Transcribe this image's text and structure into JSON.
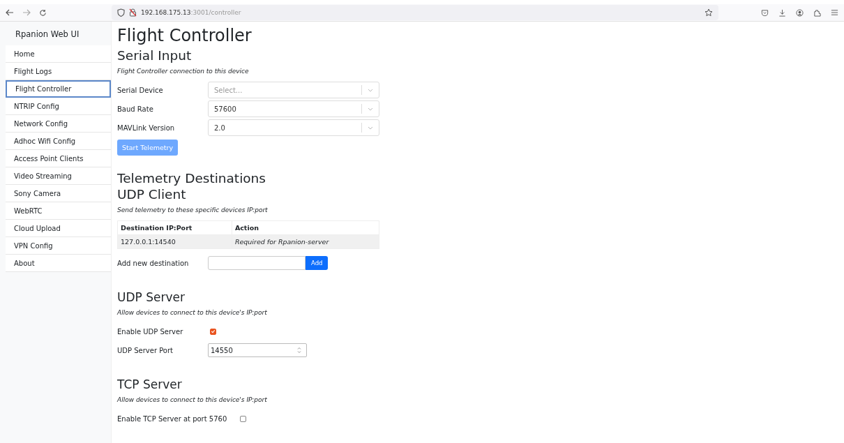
{
  "browser": {
    "address": {
      "host": "192.168.175.13",
      "path": ":3001/controller"
    }
  },
  "sidebar": {
    "brand": "Rpanion Web UI",
    "items": [
      {
        "label": "Home",
        "selected": false
      },
      {
        "label": "Flight Logs",
        "selected": false
      },
      {
        "label": "Flight Controller",
        "selected": true
      },
      {
        "label": "NTRIP Config",
        "selected": false
      },
      {
        "label": "Network Config",
        "selected": false
      },
      {
        "label": "Adhoc Wifi Config",
        "selected": false
      },
      {
        "label": "Access Point Clients",
        "selected": false
      },
      {
        "label": "Video Streaming",
        "selected": false
      },
      {
        "label": "Sony Camera",
        "selected": false
      },
      {
        "label": "WebRTC",
        "selected": false
      },
      {
        "label": "Cloud Upload",
        "selected": false
      },
      {
        "label": "VPN Config",
        "selected": false
      },
      {
        "label": "About",
        "selected": false
      }
    ]
  },
  "page_title": "Flight Controller",
  "serial_input": {
    "heading": "Serial Input",
    "subtitle": "Flight Controller connection to this device",
    "fields": [
      {
        "label": "Serial Device",
        "placeholder": "Select..."
      },
      {
        "label": "Baud Rate",
        "value": "57600"
      },
      {
        "label": "MAVLink Version",
        "value": "2.0"
      }
    ],
    "button": {
      "label": "Start Telemetry",
      "disabled": true
    }
  },
  "telemetry_heading": "Telemetry Destinations",
  "udp_client": {
    "heading": "UDP Client",
    "subtitle": "Send telemetry to these specific devices IP:port",
    "table": {
      "columns": [
        "Destination IP:Port",
        "Action"
      ],
      "rows": [
        [
          "127.0.0.1:14540",
          "Required for Rpanion-server"
        ]
      ]
    },
    "add_label": "Add new destination",
    "add_button": "Add"
  },
  "udp_server": {
    "heading": "UDP Server",
    "subtitle": "Allow devices to connect to this device's IP:port",
    "enable_label": "Enable UDP Server",
    "checked": true,
    "port_label": "UDP Server Port",
    "port_value": "14550"
  },
  "tcp_server": {
    "heading": "TCP Server",
    "subtitle": "Allow devices to connect to this device's IP:port",
    "enable_label": "Enable TCP Server at port 5760",
    "checked": false
  }
}
